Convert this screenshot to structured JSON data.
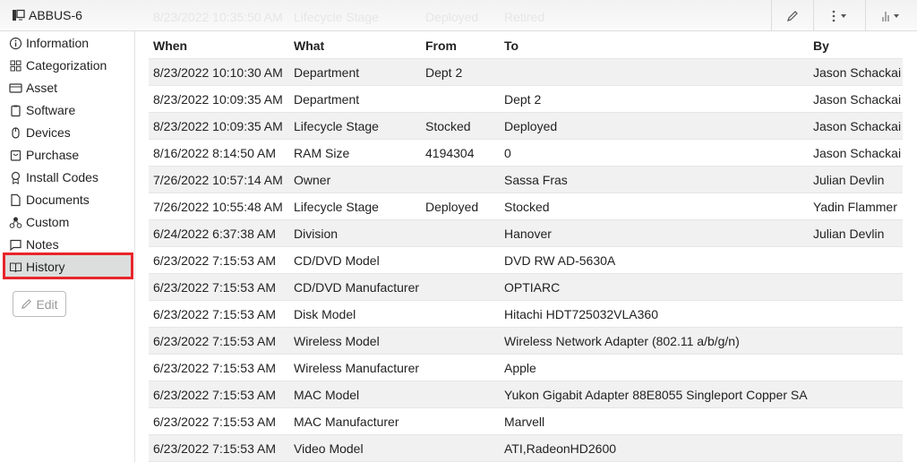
{
  "title": "ABBUS-6",
  "ghost_row": [
    "8/23/2022 10:35:50 AM",
    "Lifecycle Stage",
    "Deployed",
    "Retired"
  ],
  "toolbar": {
    "icons": [
      "pencil-icon",
      "kebab-menu-icon",
      "bar-chart-icon"
    ]
  },
  "sidebar": {
    "items": [
      {
        "label": "Information",
        "icon": "info-icon"
      },
      {
        "label": "Categorization",
        "icon": "grid-icon"
      },
      {
        "label": "Asset",
        "icon": "card-icon"
      },
      {
        "label": "Software",
        "icon": "clipboard-icon"
      },
      {
        "label": "Devices",
        "icon": "mouse-icon"
      },
      {
        "label": "Purchase",
        "icon": "bag-icon"
      },
      {
        "label": "Install Codes",
        "icon": "award-icon"
      },
      {
        "label": "Documents",
        "icon": "document-icon"
      },
      {
        "label": "Custom",
        "icon": "nodes-icon"
      },
      {
        "label": "Notes",
        "icon": "chat-icon"
      },
      {
        "label": "History",
        "icon": "book-icon"
      }
    ],
    "active": "History",
    "edit_label": "Edit"
  },
  "table": {
    "headers": [
      "When",
      "What",
      "From",
      "To",
      "By"
    ],
    "rows": [
      [
        "8/23/2022 10:10:30 AM",
        "Department",
        "Dept 2",
        "",
        "Jason Schackai"
      ],
      [
        "8/23/2022 10:09:35 AM",
        "Department",
        "",
        "Dept 2",
        "Jason Schackai"
      ],
      [
        "8/23/2022 10:09:35 AM",
        "Lifecycle Stage",
        "Stocked",
        "Deployed",
        "Jason Schackai"
      ],
      [
        "8/16/2022 8:14:50 AM",
        "RAM Size",
        "4194304",
        "0",
        "Jason Schackai"
      ],
      [
        "7/26/2022 10:57:14 AM",
        "Owner",
        "",
        "Sassa Fras",
        "Julian Devlin"
      ],
      [
        "7/26/2022 10:55:48 AM",
        "Lifecycle Stage",
        "Deployed",
        "Stocked",
        "Yadin Flammer"
      ],
      [
        "6/24/2022 6:37:38 AM",
        "Division",
        "",
        "Hanover",
        "Julian Devlin"
      ],
      [
        "6/23/2022 7:15:53 AM",
        "CD/DVD Model",
        "",
        "DVD RW AD-5630A",
        ""
      ],
      [
        "6/23/2022 7:15:53 AM",
        "CD/DVD Manufacturer",
        "",
        "OPTIARC",
        ""
      ],
      [
        "6/23/2022 7:15:53 AM",
        "Disk Model",
        "",
        "Hitachi HDT725032VLA360",
        ""
      ],
      [
        "6/23/2022 7:15:53 AM",
        "Wireless Model",
        "",
        "Wireless Network Adapter (802.11 a/b/g/n)",
        ""
      ],
      [
        "6/23/2022 7:15:53 AM",
        "Wireless Manufacturer",
        "",
        "Apple",
        ""
      ],
      [
        "6/23/2022 7:15:53 AM",
        "MAC Model",
        "",
        "Yukon Gigabit Adapter 88E8055 Singleport Copper SA",
        ""
      ],
      [
        "6/23/2022 7:15:53 AM",
        "MAC Manufacturer",
        "",
        "Marvell",
        ""
      ],
      [
        "6/23/2022 7:15:53 AM",
        "Video Model",
        "",
        "ATI,RadeonHD2600",
        ""
      ]
    ]
  }
}
